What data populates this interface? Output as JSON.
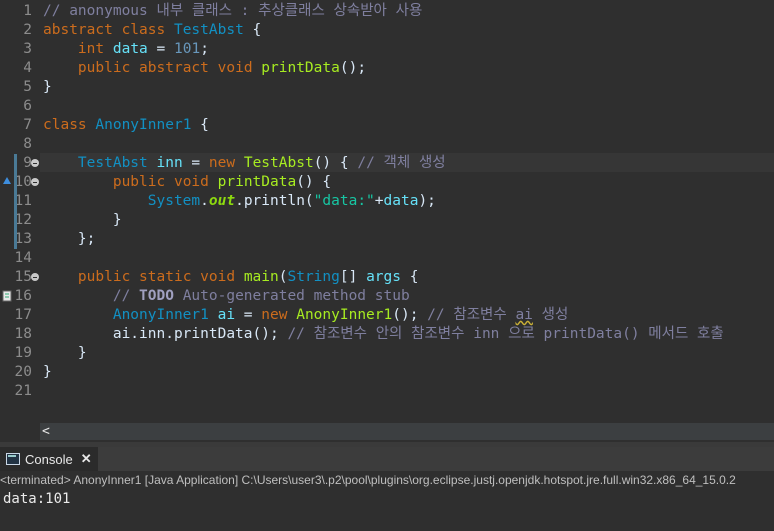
{
  "editor": {
    "line_numbers": [
      "1",
      "2",
      "3",
      "4",
      "5",
      "6",
      "7",
      "8",
      "9",
      "10",
      "11",
      "12",
      "13",
      "14",
      "15",
      "16",
      "17",
      "18",
      "19",
      "20",
      "21"
    ],
    "lines": [
      {
        "segments": [
          [
            "cm",
            "// anonymous 내부 클래스 : 추상클래스 상속받아 사용"
          ]
        ]
      },
      {
        "segments": [
          [
            "kw",
            "abstract"
          ],
          [
            "",
            " "
          ],
          [
            "kw",
            "class"
          ],
          [
            "",
            " "
          ],
          [
            "ty",
            "TestAbst"
          ],
          [
            "",
            " {"
          ]
        ]
      },
      {
        "segments": [
          [
            "",
            "    "
          ],
          [
            "kw",
            "int"
          ],
          [
            "",
            " "
          ],
          [
            "vr",
            "data"
          ],
          [
            "",
            " = "
          ],
          [
            "nm",
            "101"
          ],
          [
            "",
            ";"
          ]
        ]
      },
      {
        "segments": [
          [
            "",
            "    "
          ],
          [
            "kw",
            "public"
          ],
          [
            "",
            " "
          ],
          [
            "kw",
            "abstract"
          ],
          [
            "",
            " "
          ],
          [
            "kw",
            "void"
          ],
          [
            "",
            " "
          ],
          [
            "mt",
            "printData"
          ],
          [
            "",
            "();"
          ]
        ]
      },
      {
        "segments": [
          [
            "",
            "}"
          ]
        ]
      },
      {
        "segments": []
      },
      {
        "segments": [
          [
            "kw",
            "class"
          ],
          [
            "",
            " "
          ],
          [
            "ty",
            "AnonyInner1"
          ],
          [
            "",
            " {"
          ]
        ]
      },
      {
        "segments": []
      },
      {
        "segments": [
          [
            "",
            "    "
          ],
          [
            "ty",
            "TestAbst"
          ],
          [
            "",
            " "
          ],
          [
            "vr",
            "inn"
          ],
          [
            "",
            " = "
          ],
          [
            "kw",
            "new"
          ],
          [
            "",
            " "
          ],
          [
            "mt",
            "TestAbst"
          ],
          [
            "",
            "() { "
          ],
          [
            "cm",
            "// 객체 생성"
          ]
        ]
      },
      {
        "segments": [
          [
            "",
            "        "
          ],
          [
            "kw",
            "public"
          ],
          [
            "",
            " "
          ],
          [
            "kw",
            "void"
          ],
          [
            "",
            " "
          ],
          [
            "mt",
            "printData"
          ],
          [
            "",
            "() {"
          ]
        ]
      },
      {
        "segments": [
          [
            "",
            "            "
          ],
          [
            "ty",
            "System"
          ],
          [
            "",
            "."
          ],
          [
            "sf",
            "out"
          ],
          [
            "",
            ".println("
          ],
          [
            "st",
            "\"data:\""
          ],
          [
            "",
            "+"
          ],
          [
            "vr",
            "data"
          ],
          [
            "",
            ");"
          ]
        ]
      },
      {
        "segments": [
          [
            "",
            "        }"
          ]
        ]
      },
      {
        "segments": [
          [
            "",
            "    };"
          ]
        ]
      },
      {
        "segments": []
      },
      {
        "segments": [
          [
            "",
            "    "
          ],
          [
            "kw",
            "public"
          ],
          [
            "",
            " "
          ],
          [
            "kw",
            "static"
          ],
          [
            "",
            " "
          ],
          [
            "kw",
            "void"
          ],
          [
            "",
            " "
          ],
          [
            "mt",
            "main"
          ],
          [
            "",
            "("
          ],
          [
            "ty",
            "String"
          ],
          [
            "",
            "[] "
          ],
          [
            "vr",
            "args"
          ],
          [
            "",
            " {"
          ]
        ]
      },
      {
        "segments": [
          [
            "",
            "        "
          ],
          [
            "cm",
            "// "
          ],
          [
            "todo",
            "TODO"
          ],
          [
            "cm",
            " Auto-generated method stub"
          ]
        ]
      },
      {
        "segments": [
          [
            "",
            "        "
          ],
          [
            "ty",
            "AnonyInner1"
          ],
          [
            "",
            " "
          ],
          [
            "vr",
            "ai"
          ],
          [
            "",
            " = "
          ],
          [
            "kw",
            "new"
          ],
          [
            "",
            " "
          ],
          [
            "mt",
            "AnonyInner1"
          ],
          [
            "",
            "(); "
          ],
          [
            "cm",
            "// 참조변수 "
          ],
          [
            "cmul",
            "ai"
          ],
          [
            "cm",
            " 생성"
          ]
        ]
      },
      {
        "segments": [
          [
            "",
            "        ai.inn.printData(); "
          ],
          [
            "cm",
            "// 참조변수 안의 참조변수 inn 으로 printData() 메서드 호출"
          ]
        ]
      },
      {
        "segments": [
          [
            "",
            "    }"
          ]
        ]
      },
      {
        "segments": [
          [
            "",
            "}"
          ]
        ]
      },
      {
        "segments": []
      }
    ],
    "scroll_arrow": "<"
  },
  "console": {
    "tab_label": "Console",
    "close_glyph": "✕",
    "terminated_text": "<terminated> AnonyInner1 [Java Application] C:\\Users\\user3\\.p2\\pool\\plugins\\org.eclipse.justj.openjdk.hotspot.jre.full.win32.x86_64_15.0.2",
    "output": "data:101"
  },
  "colors": {
    "keyword": "#cc6c1d",
    "type": "#1290c3",
    "comment": "#7f7f9f",
    "method": "#a7ec21",
    "string": "#17c6a3",
    "background": "#2f2f2f"
  }
}
